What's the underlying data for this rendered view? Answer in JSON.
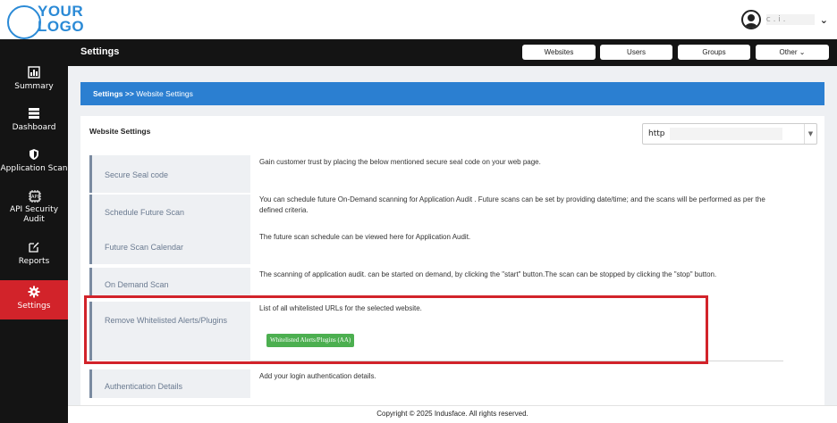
{
  "logo": {
    "line1": "YOUR",
    "line2": "LOGO"
  },
  "user": {
    "name": "c . i .",
    "icon": "user-circle-icon",
    "menu_icon": "chevron-down-icon"
  },
  "sidebar": {
    "items": [
      {
        "label": "Summary",
        "icon": "summary-icon"
      },
      {
        "label": "Dashboard",
        "icon": "dashboard-icon"
      },
      {
        "label": "Application Scan",
        "icon": "shield-icon"
      },
      {
        "label": "API Security Audit",
        "icon": "api-icon"
      },
      {
        "label": "Reports",
        "icon": "edit-report-icon"
      },
      {
        "label": "Settings",
        "icon": "gear-icon",
        "active": true
      }
    ]
  },
  "header": {
    "title": "Settings",
    "buttons": {
      "websites": "Websites",
      "users": "Users",
      "groups": "Groups",
      "other": "Other ⌄"
    }
  },
  "breadcrumb": {
    "root": "Settings",
    "sep": " >> ",
    "current": "Website Settings"
  },
  "panel": {
    "title": "Website Settings",
    "website_select": {
      "value": "http"
    }
  },
  "rows": [
    {
      "label": "Secure Seal code",
      "desc": "Gain customer trust by placing the below mentioned secure seal code on your web page."
    },
    {
      "label": "Schedule Future Scan",
      "desc": "You can schedule future On-Demand scanning for Application Audit . Future scans can be set by providing date/time; and the scans will be performed as per the defined criteria."
    },
    {
      "label": "Future Scan Calendar",
      "desc": "The future scan schedule can be viewed here for Application Audit."
    },
    {
      "label": "On Demand Scan",
      "desc": "The scanning of application audit. can be started on demand, by clicking the \"start\" button.The scan can be stopped by clicking the \"stop\" button."
    },
    {
      "label": "Remove Whitelisted Alerts/Plugins",
      "desc": "List of all whitelisted URLs for the selected website.",
      "button": "Whitelisted Alerts/Plugins (AA)"
    },
    {
      "label": "Authentication Details",
      "desc": "Add your login authentication details."
    }
  ],
  "footer": {
    "text": "Copyright © 2025 Indusface. All rights reserved."
  },
  "colors": {
    "accent_blue": "#2b7fd1",
    "active_red": "#d2232a",
    "sidebar_bg": "#141414",
    "button_green": "#4caf50"
  }
}
